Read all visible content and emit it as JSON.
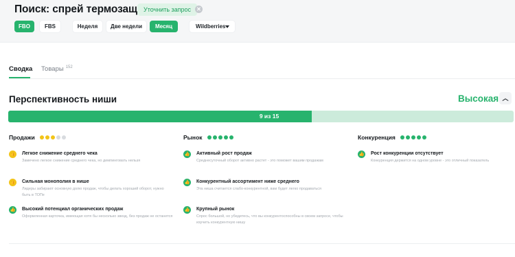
{
  "header": {
    "title": "Поиск: спрей термозащита",
    "refine_label": "Уточнить запрос",
    "clear_icon": "close-icon"
  },
  "filters": {
    "scheme": [
      {
        "label": "FBO",
        "active": true
      },
      {
        "label": "FBS",
        "active": false
      }
    ],
    "period": [
      {
        "label": "Неделя",
        "active": false
      },
      {
        "label": "Две недели",
        "active": false
      },
      {
        "label": "Месяц",
        "active": true
      }
    ],
    "marketplace": {
      "label": "Wildberries",
      "icon": "caret-down-icon"
    }
  },
  "tabs": [
    {
      "label": "Сводка",
      "active": true
    },
    {
      "label": "Товары",
      "count": "152",
      "active": false
    }
  ],
  "niche": {
    "title": "Перспективность ниши",
    "level": "Высокая",
    "collapse_icon": "chevron-up-icon",
    "score": 9,
    "max": 15,
    "score_label": "9 из 15"
  },
  "columns": [
    {
      "title": "Продажи",
      "rating": 3,
      "rating_max": 5,
      "rating_color": "#f2c418",
      "items": [
        {
          "status": "neutral",
          "title": "Легкое снижение среднего чека",
          "desc": "Замечено легкое снижение среднего чека, но демпинговать нельзя"
        },
        {
          "status": "neutral",
          "title": "Сильная монополия в нише",
          "desc": "Лидеры забирают основную долю продаж, чтобы делать хороший оборот, нужно быть в ТОПе"
        },
        {
          "status": "good",
          "title": "Высокий потенциал органических продаж",
          "desc": "Оформленная карточка, имеющая хотя бы несколько звезд, без продаж не останется"
        }
      ]
    },
    {
      "title": "Рынок",
      "rating": 5,
      "rating_max": 5,
      "rating_color": "#27b36d",
      "items": [
        {
          "status": "good",
          "title": "Активный рост продаж",
          "desc": "Среднесуточный оборот активно растет - это поможет вашим продажам"
        },
        {
          "status": "good",
          "title": "Конкурентный ассортимент ниже среднего",
          "desc": "Эта ниша считается слабо-конкурентной, вам будет легко продаваться"
        },
        {
          "status": "good",
          "title": "Крупный рынок",
          "desc": "Спрос большой, но убедитесь, что вы конкурентоспособны в своем запросе, чтобы изучить конкурентную нишу"
        }
      ]
    },
    {
      "title": "Конкуренция",
      "rating": 5,
      "rating_max": 5,
      "rating_color": "#27b36d",
      "items": [
        {
          "status": "good",
          "title": "Рост конкуренции отсутствует",
          "desc": "Конкуренция держится на одном уровне - это отличный показатель"
        }
      ]
    }
  ],
  "colors": {
    "accent": "#27b36d",
    "warning": "#f2c418",
    "track": "#ccebdb"
  }
}
